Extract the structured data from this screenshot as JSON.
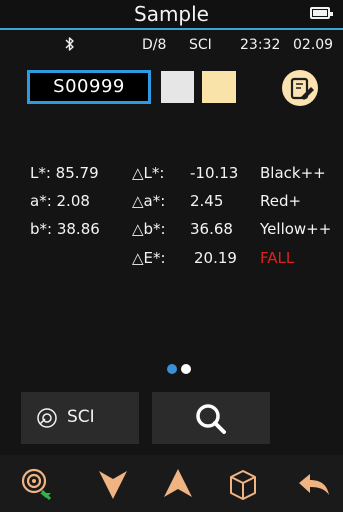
{
  "header": {
    "title": "Sample"
  },
  "status": {
    "mode": "D/8",
    "specular": "SCI",
    "time": "23:32",
    "date": "02.09"
  },
  "sample": {
    "id": "S00999",
    "standard_color": "#e6e6e6",
    "sample_color": "#fae3a8"
  },
  "readings": {
    "L": "L*: 85.79",
    "a": "a*: 2.08",
    "b": "b*: 38.86"
  },
  "deltas": {
    "dL_label": "△L*:",
    "dL_value": "-10.13",
    "dL_desc": "Black++",
    "da_label": "△a*:",
    "da_value": "2.45",
    "da_desc": "Red+",
    "db_label": "△b*:",
    "db_value": "36.68",
    "db_desc": "Yellow++",
    "dE_label": "△E*:",
    "dE_value": "20.19",
    "result": "FALL"
  },
  "colors": {
    "accent": "#3fa4d3",
    "highlight": "#2d9be1",
    "fail": "#e02020",
    "toolbar_icon": "#f0b483"
  },
  "pager": {
    "pages": 2,
    "current": 1
  },
  "buttons": {
    "sci_label": "SCI"
  },
  "toolbar": {
    "icons": [
      "measure-icon",
      "arrow-down-icon",
      "arrow-up-icon",
      "cube-icon",
      "back-icon"
    ]
  }
}
